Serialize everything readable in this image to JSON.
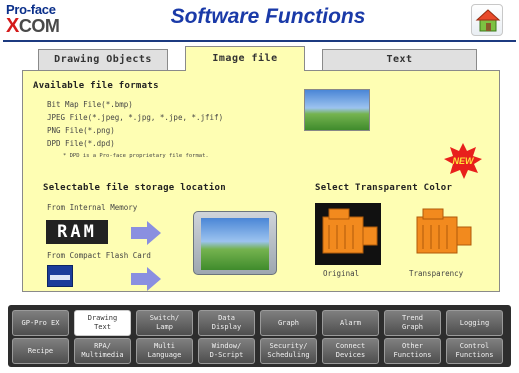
{
  "header": {
    "logo_top": "Pro-face",
    "logo_x": "X",
    "logo_rest": "COM",
    "title": "Software Functions",
    "home_icon": "home-icon"
  },
  "tabs": [
    {
      "label": "Drawing Objects",
      "active": false
    },
    {
      "label": "Image file",
      "active": true
    },
    {
      "label": "Text",
      "active": false
    }
  ],
  "panel": {
    "formats_heading": "Available file formats",
    "formats": [
      "Bit Map File(*.bmp)",
      "JPEG File(*.jpeg, *.jpg, *.jpe, *.jfif)",
      "PNG File(*.png)",
      "DPD File(*.dpd)"
    ],
    "dpd_note": "* DPD is a Pro-face proprietary file format.",
    "storage_heading": "Selectable file storage location",
    "internal_label": "From Internal Memory",
    "ram_label": "RAM",
    "cf_label": "From Compact Flash Card",
    "transparent_heading": "Select Transparent Color",
    "original_label": "Original",
    "transparency_label": "Transparency",
    "badge": "NEW"
  },
  "nav": {
    "row1": [
      "GP-Pro EX",
      "Drawing\nText",
      "Switch/\nLamp",
      "Data\nDisplay",
      "Graph",
      "Alarm",
      "Trend\nGraph",
      "Logging"
    ],
    "row2": [
      "Recipe",
      "RPA/\nMultimedia",
      "Multi\nLanguage",
      "Window/\nD-Script",
      "Security/\nScheduling",
      "Connect\nDevices",
      "Other\nFunctions",
      "Control\nFunctions"
    ],
    "active": "Drawing\nText"
  },
  "colors": {
    "panel_bg": "#fefeb3",
    "title_blue": "#1a3aa8",
    "motor_orange": "#f28a1e",
    "nav_bg": "#2d2d2d"
  }
}
